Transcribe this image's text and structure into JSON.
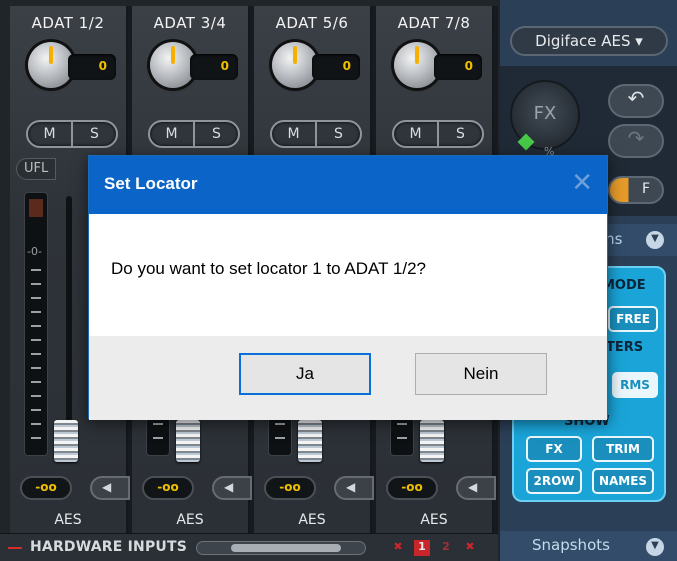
{
  "channels": [
    {
      "name": "ADAT 1/2",
      "gain": "0",
      "mute": "M",
      "solo": "S",
      "volume": "-oo",
      "output": "AES"
    },
    {
      "name": "ADAT 3/4",
      "gain": "0",
      "mute": "M",
      "solo": "S",
      "volume": "-oo",
      "output": "AES"
    },
    {
      "name": "ADAT 5/6",
      "gain": "0",
      "mute": "M",
      "solo": "S",
      "volume": "-oo",
      "output": "AES"
    },
    {
      "name": "ADAT 7/8",
      "gain": "0",
      "mute": "M",
      "solo": "S",
      "volume": "-oo",
      "output": "AES"
    }
  ],
  "channel_ufl": "UFL",
  "meter_zero_label": "-0-",
  "bottom": {
    "section_label": "HARDWARE INPUTS",
    "locators": [
      "1",
      "2"
    ]
  },
  "right_panel": {
    "device": "Digiface AES",
    "fx_label": "FX",
    "fx_percent": "%",
    "f_label": "F",
    "options_label": "ons",
    "mode_label": "MODE",
    "free_label": "FREE",
    "meters_label": "TERS",
    "rms_label": "RMS",
    "show_label": "SHOW",
    "fx_btn": "FX",
    "trim_btn": "TRIM",
    "two_row_btn": "2ROW",
    "names_btn": "NAMES",
    "snapshots_label": "Snapshots"
  },
  "dialog": {
    "title": "Set Locator",
    "message": "Do you want to set locator 1 to ADAT 1/2?",
    "yes_label": "Ja",
    "no_label": "Nein"
  },
  "colors": {
    "dialog_title_bar": "#0b64c7",
    "accent_yellow": "#f0c000",
    "options_panel": "#1aa4d8",
    "locator_red": "#c8262b"
  }
}
